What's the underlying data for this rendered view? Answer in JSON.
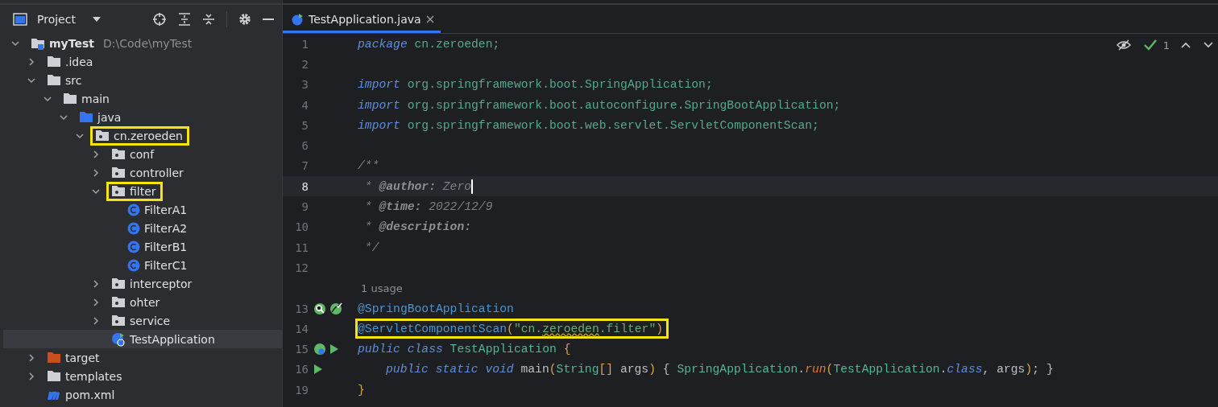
{
  "project_panel": {
    "title": "Project",
    "tree": [
      {
        "label": "myTest",
        "path": "D:\\Code\\myTest",
        "kind": "module",
        "expanded": true,
        "selected": false,
        "highlighted": false,
        "children": [
          {
            "label": ".idea",
            "kind": "folder",
            "expanded": false,
            "selected": false,
            "highlighted": false
          },
          {
            "label": "src",
            "kind": "folder",
            "expanded": true,
            "selected": false,
            "highlighted": false,
            "children": [
              {
                "label": "main",
                "kind": "folder",
                "expanded": true,
                "selected": false,
                "highlighted": false,
                "children": [
                  {
                    "label": "java",
                    "kind": "source-folder",
                    "expanded": true,
                    "selected": false,
                    "highlighted": false,
                    "children": [
                      {
                        "label": "cn.zeroeden",
                        "kind": "package",
                        "expanded": true,
                        "selected": false,
                        "highlighted": true,
                        "children": [
                          {
                            "label": "conf",
                            "kind": "package",
                            "expanded": false,
                            "selected": false,
                            "highlighted": false
                          },
                          {
                            "label": "controller",
                            "kind": "package",
                            "expanded": false,
                            "selected": false,
                            "highlighted": false
                          },
                          {
                            "label": "filter",
                            "kind": "package",
                            "expanded": true,
                            "selected": false,
                            "highlighted": true,
                            "children": [
                              {
                                "label": "FilterA1",
                                "kind": "class",
                                "selected": false,
                                "highlighted": false
                              },
                              {
                                "label": "FilterA2",
                                "kind": "class",
                                "selected": false,
                                "highlighted": false
                              },
                              {
                                "label": "FilterB1",
                                "kind": "class",
                                "selected": false,
                                "highlighted": false
                              },
                              {
                                "label": "FilterC1",
                                "kind": "class",
                                "selected": false,
                                "highlighted": false
                              }
                            ]
                          },
                          {
                            "label": "interceptor",
                            "kind": "package",
                            "expanded": false,
                            "selected": false,
                            "highlighted": false
                          },
                          {
                            "label": "ohter",
                            "kind": "package",
                            "expanded": false,
                            "selected": false,
                            "highlighted": false
                          },
                          {
                            "label": "service",
                            "kind": "package",
                            "expanded": false,
                            "selected": false,
                            "highlighted": false
                          },
                          {
                            "label": "TestApplication",
                            "kind": "app-class",
                            "selected": true,
                            "highlighted": false
                          }
                        ]
                      }
                    ]
                  }
                ]
              }
            ]
          },
          {
            "label": "target",
            "kind": "excluded-folder",
            "expanded": false,
            "selected": false,
            "highlighted": false
          },
          {
            "label": "templates",
            "kind": "folder",
            "expanded": false,
            "selected": false,
            "highlighted": false
          },
          {
            "label": "pom.xml",
            "kind": "maven",
            "selected": false,
            "highlighted": false
          }
        ]
      }
    ]
  },
  "editor": {
    "tabs": [
      {
        "label": "TestApplication.java",
        "selected": true
      }
    ],
    "inspection_count": "1",
    "lines": [
      {
        "number": "1",
        "current": false,
        "tokens": [
          {
            "kind": "keyword",
            "text": "package"
          },
          {
            "kind": "pkg",
            "text": " cn.zeroeden;"
          }
        ]
      },
      {
        "number": "2",
        "current": false
      },
      {
        "number": "3",
        "current": false,
        "tokens": [
          {
            "kind": "keyword",
            "text": "import"
          },
          {
            "kind": "pkg",
            "text": " org.springframework.boot.SpringApplication;"
          }
        ]
      },
      {
        "number": "4",
        "current": false,
        "tokens": [
          {
            "kind": "keyword",
            "text": "import"
          },
          {
            "kind": "pkg",
            "text": " org.springframework.boot.autoconfigure.SpringBootApplication;"
          }
        ]
      },
      {
        "number": "5",
        "current": false,
        "tokens": [
          {
            "kind": "keyword",
            "text": "import"
          },
          {
            "kind": "pkg",
            "text": " org.springframework.boot.web.servlet.ServletComponentScan;"
          }
        ]
      },
      {
        "number": "6",
        "current": false
      },
      {
        "number": "7",
        "current": false,
        "tokens": [
          {
            "kind": "comment",
            "text": "/**"
          }
        ]
      },
      {
        "number": "8",
        "current": true,
        "tokens": [
          {
            "kind": "comment",
            "text": " * "
          },
          {
            "kind": "doctag",
            "text": "@author:"
          },
          {
            "kind": "comment",
            "text": " Zero"
          }
        ]
      },
      {
        "number": "9",
        "current": false,
        "tokens": [
          {
            "kind": "comment",
            "text": " * "
          },
          {
            "kind": "doctag",
            "text": "@time:"
          },
          {
            "kind": "comment",
            "text": " 2022/12/9"
          }
        ]
      },
      {
        "number": "10",
        "current": false,
        "tokens": [
          {
            "kind": "comment",
            "text": " * "
          },
          {
            "kind": "doctag",
            "text": "@description:"
          }
        ]
      },
      {
        "number": "11",
        "current": false,
        "tokens": [
          {
            "kind": "comment",
            "text": " */"
          }
        ]
      },
      {
        "number": "12",
        "current": false
      },
      {
        "number": "13",
        "current": false,
        "hint": "1 usage",
        "gutter": [
          {
            "kind": "bean-search"
          },
          {
            "kind": "bean-check"
          }
        ],
        "tokens": [
          {
            "kind": "annotation",
            "text": "@SpringBootApplication"
          }
        ]
      },
      {
        "number": "14",
        "current": false,
        "boxed": true,
        "tokens": [
          {
            "kind": "annotation",
            "text": "@ServletComponentScan"
          },
          {
            "kind": "brace",
            "text": "("
          },
          {
            "kind": "string",
            "text": "\"cn."
          },
          {
            "kind": "typo",
            "text": "zeroeden"
          },
          {
            "kind": "string",
            "text": ".filter\""
          },
          {
            "kind": "brace",
            "text": ")"
          }
        ]
      },
      {
        "number": "15",
        "current": false,
        "gutter": [
          {
            "kind": "bean"
          },
          {
            "kind": "run"
          }
        ],
        "tokens": [
          {
            "kind": "keyword",
            "text": "public class"
          },
          {
            "kind": "class",
            "text": " TestApplication "
          },
          {
            "kind": "brace",
            "text": "{"
          }
        ]
      },
      {
        "number": "16",
        "current": false,
        "indented": true,
        "gutter": [
          {
            "kind": "run"
          }
        ],
        "tokens": [
          {
            "kind": "keyword",
            "text": "public static void"
          },
          {
            "kind": "plain",
            "text": " main"
          },
          {
            "kind": "brace",
            "text": "("
          },
          {
            "kind": "class",
            "text": "String"
          },
          {
            "kind": "brace",
            "text": "[]"
          },
          {
            "kind": "plain",
            "text": " args"
          },
          {
            "kind": "brace",
            "text": ")"
          },
          {
            "kind": "plain",
            "text": " { "
          },
          {
            "kind": "class",
            "text": "SpringApplication"
          },
          {
            "kind": "plain",
            "text": "."
          },
          {
            "kind": "method",
            "text": "run"
          },
          {
            "kind": "brace",
            "text": "("
          },
          {
            "kind": "class",
            "text": "TestApplication"
          },
          {
            "kind": "plain",
            "text": "."
          },
          {
            "kind": "keyword",
            "text": "class"
          },
          {
            "kind": "plain",
            "text": ", args"
          },
          {
            "kind": "brace",
            "text": ")"
          },
          {
            "kind": "plain",
            "text": "; }"
          }
        ]
      },
      {
        "number": "19",
        "current": false,
        "tokens": [
          {
            "kind": "brace",
            "text": "}"
          }
        ]
      }
    ]
  }
}
